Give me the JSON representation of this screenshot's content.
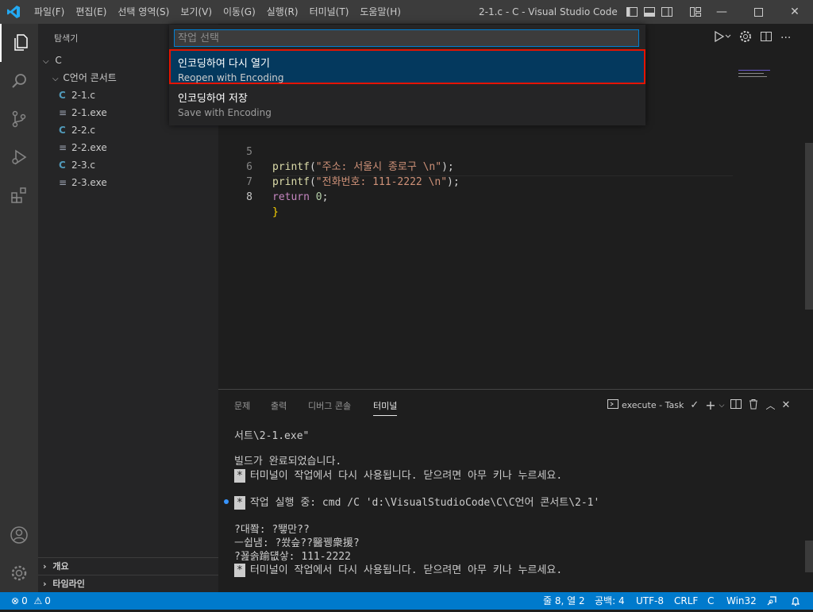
{
  "titlebar": {
    "menu": [
      "파일(F)",
      "편집(E)",
      "선택 영역(S)",
      "보기(V)",
      "이동(G)",
      "실행(R)",
      "터미널(T)",
      "도움말(H)"
    ],
    "window_title": "2-1.c - C - Visual Studio Code"
  },
  "sidebar": {
    "title": "탐색기",
    "root": "C",
    "folder": "C언어 콘서트",
    "files": [
      "2-1.c",
      "2-1.exe",
      "2-2.c",
      "2-2.exe",
      "2-3.c",
      "2-3.exe"
    ],
    "section_outline": "개요",
    "section_timeline": "타임라인"
  },
  "palette": {
    "placeholder": "작업 선택",
    "items": [
      {
        "label": "인코딩하여 다시 열기",
        "description": "Reopen with Encoding"
      },
      {
        "label": "인코딩하여 저장",
        "description": "Save with Encoding"
      }
    ]
  },
  "editor": {
    "lines": [
      {
        "num": "5",
        "fn": "printf",
        "open": "(",
        "str": "\"주소: 서울시 종로구 \\n\"",
        "close": ");"
      },
      {
        "num": "6",
        "fn": "printf",
        "open": "(",
        "str": "\"전화번호: 111-2222 \\n\"",
        "close": ");"
      },
      {
        "num": "7",
        "kw": "return",
        "val": "0",
        "close": ";"
      },
      {
        "num": "8",
        "brace": "}"
      }
    ]
  },
  "panel": {
    "tabs": [
      "문제",
      "출력",
      "디버그 콘솔",
      "터미널"
    ],
    "active_tab": "터미널",
    "task_label": "execute - Task",
    "terminal_lines": [
      "서트\\2-1.exe\"",
      "빌드가 완료되었습니다.",
      "터미널이 작업에서 다시 사용됩니다. 닫으려면 아무 키나 누르세요.",
      "작업 실행 중: cmd /C 'd:\\VisualStudioCode\\C\\C언어 콘서트\\2-1'",
      "?대쫰: ?뙣만??",
      "ㅡ쉽냄: ?쐈슾??醫뀅衆援?",
      "?꾪솕踰덊샇: 111-2222",
      "터미널이 작업에서 다시 사용됩니다. 닫으려면 아무 키나 누르세요."
    ],
    "star": "*"
  },
  "statusbar": {
    "errors": "0",
    "warnings": "0",
    "position": "줄 8, 열 2",
    "spaces": "공백: 4",
    "encoding": "UTF-8",
    "eol": "CRLF",
    "language": "C",
    "platform": "Win32"
  },
  "colors": {
    "accent": "#007acc",
    "highlight_border": "#e51400",
    "selection": "#04395e"
  }
}
